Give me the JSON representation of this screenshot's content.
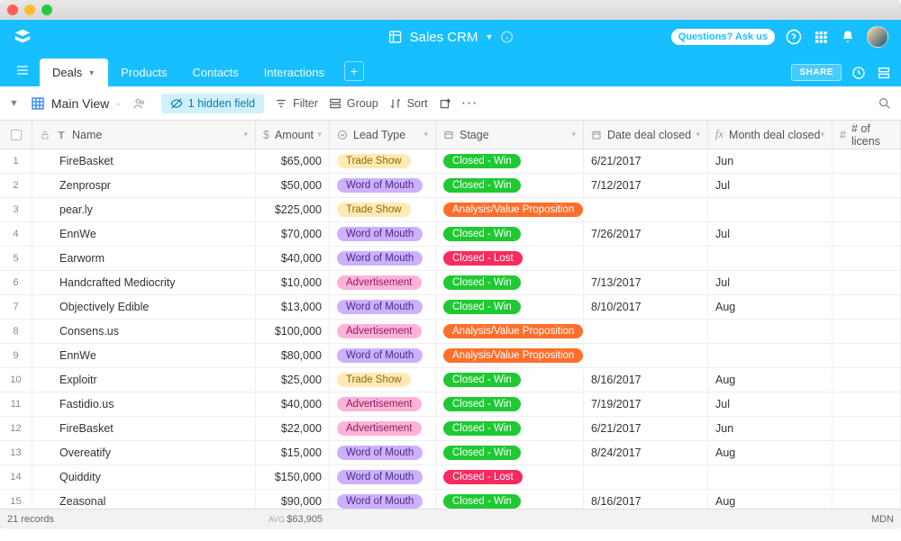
{
  "app": {
    "title": "Sales CRM"
  },
  "topbar": {
    "questions_label": "Questions? Ask us"
  },
  "tabs": {
    "items": [
      "Deals",
      "Products",
      "Contacts",
      "Interactions"
    ],
    "active_index": 0,
    "share_label": "SHARE"
  },
  "viewbar": {
    "view_name": "Main View",
    "hidden_field_label": "1 hidden field",
    "filter_label": "Filter",
    "group_label": "Group",
    "sort_label": "Sort"
  },
  "columns": {
    "name": "Name",
    "amount": "Amount",
    "lead_type": "Lead Type",
    "stage": "Stage",
    "date_closed": "Date deal closed",
    "month_closed": "Month deal closed",
    "licenses": "# of licens"
  },
  "lead_types": {
    "trade": "Trade Show",
    "word": "Word of Mouth",
    "ad": "Advertisement"
  },
  "stages": {
    "win": "Closed - Win",
    "lost": "Closed - Lost",
    "analysis": "Analysis/Value Proposition"
  },
  "rows": [
    {
      "name": "FireBasket",
      "amount": "$65,000",
      "lead": "trade",
      "stage": "win",
      "date": "6/21/2017",
      "month": "Jun"
    },
    {
      "name": "Zenprospr",
      "amount": "$50,000",
      "lead": "word",
      "stage": "win",
      "date": "7/12/2017",
      "month": "Jul"
    },
    {
      "name": "pear.ly",
      "amount": "$225,000",
      "lead": "trade",
      "stage": "analysis",
      "date": "",
      "month": ""
    },
    {
      "name": "EnnWe",
      "amount": "$70,000",
      "lead": "word",
      "stage": "win",
      "date": "7/26/2017",
      "month": "Jul"
    },
    {
      "name": "Earworm",
      "amount": "$40,000",
      "lead": "word",
      "stage": "lost",
      "date": "",
      "month": ""
    },
    {
      "name": "Handcrafted Mediocrity",
      "amount": "$10,000",
      "lead": "ad",
      "stage": "win",
      "date": "7/13/2017",
      "month": "Jul"
    },
    {
      "name": "Objectively Edible",
      "amount": "$13,000",
      "lead": "word",
      "stage": "win",
      "date": "8/10/2017",
      "month": "Aug"
    },
    {
      "name": "Consens.us",
      "amount": "$100,000",
      "lead": "ad",
      "stage": "analysis",
      "date": "",
      "month": ""
    },
    {
      "name": "EnnWe",
      "amount": "$80,000",
      "lead": "word",
      "stage": "analysis",
      "date": "",
      "month": ""
    },
    {
      "name": "Exploitr",
      "amount": "$25,000",
      "lead": "trade",
      "stage": "win",
      "date": "8/16/2017",
      "month": "Aug"
    },
    {
      "name": "Fastidio.us",
      "amount": "$40,000",
      "lead": "ad",
      "stage": "win",
      "date": "7/19/2017",
      "month": "Jul"
    },
    {
      "name": "FireBasket",
      "amount": "$22,000",
      "lead": "ad",
      "stage": "win",
      "date": "6/21/2017",
      "month": "Jun"
    },
    {
      "name": "Overeatify",
      "amount": "$15,000",
      "lead": "word",
      "stage": "win",
      "date": "8/24/2017",
      "month": "Aug"
    },
    {
      "name": "Quiddity",
      "amount": "$150,000",
      "lead": "word",
      "stage": "lost",
      "date": "",
      "month": ""
    },
    {
      "name": "Zeasonal",
      "amount": "$90,000",
      "lead": "word",
      "stage": "win",
      "date": "8/16/2017",
      "month": "Aug"
    }
  ],
  "footer": {
    "records": "21 records",
    "avg_label": "AVG",
    "avg_value": "$63,905",
    "mdn_label": "MDN"
  }
}
